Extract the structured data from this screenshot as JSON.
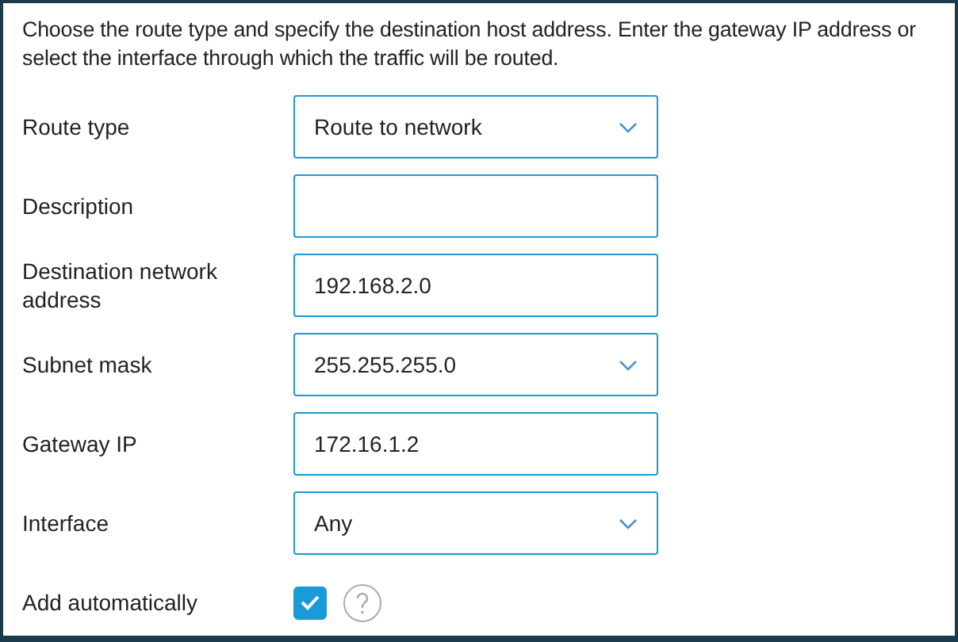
{
  "intro": "Choose the route type and specify the destination host address. Enter the gateway IP address or select the interface through which the traffic will be routed.",
  "fields": [
    {
      "kind": "select",
      "label": "Route type",
      "value": "Route to network"
    },
    {
      "kind": "text",
      "label": "Description"
    },
    {
      "kind": "text",
      "label": "Destination network address",
      "value": "192.168.2.0"
    },
    {
      "kind": "select",
      "label": "Subnet mask",
      "value": "255.255.255.0"
    },
    {
      "kind": "text",
      "label": "Gateway IP",
      "value": "172.16.1.2"
    },
    {
      "kind": "select",
      "label": "Interface",
      "value": "Any"
    },
    {
      "kind": "checkbox",
      "label": "Add automatically",
      "checked": true,
      "help": true
    }
  ]
}
